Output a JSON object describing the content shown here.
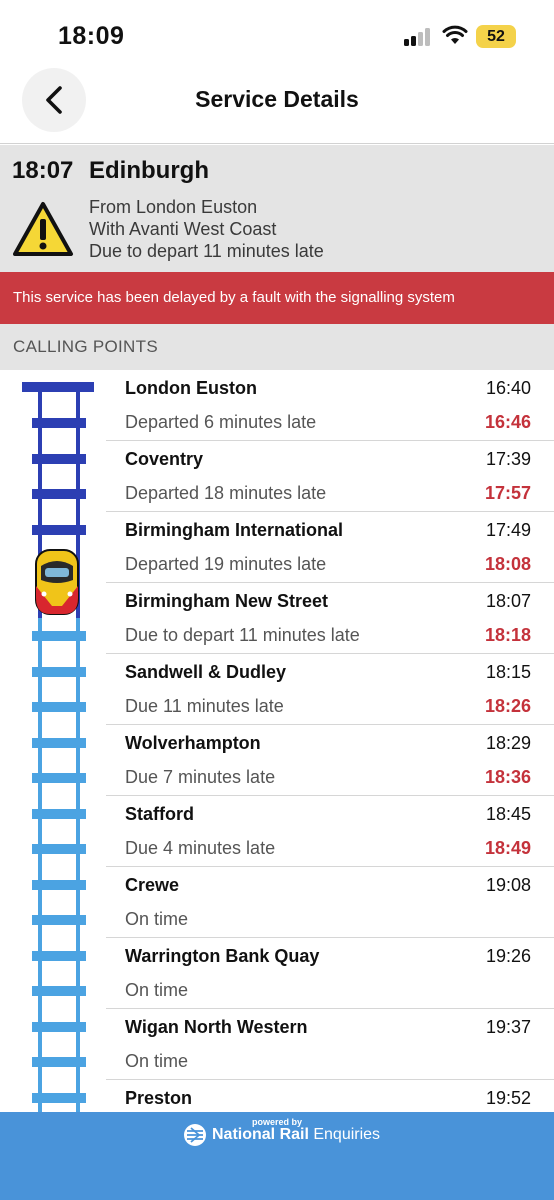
{
  "status_bar": {
    "time": "18:09",
    "battery": "52"
  },
  "header": {
    "title": "Service Details"
  },
  "service": {
    "time": "18:07",
    "destination": "Edinburgh",
    "lines": [
      "From London Euston",
      "With Avanti West Coast",
      "Due to depart 11 minutes late"
    ]
  },
  "alert": "This service has been delayed by a fault with the signalling system",
  "section_title": "CALLING POINTS",
  "colors": {
    "alert": "#c93a41",
    "late": "#c4323b",
    "track_passed": "#2c3fb3",
    "track_ahead": "#4ba3e2",
    "footer": "#4993d9"
  },
  "stops": [
    {
      "name": "London Euston",
      "scheduled": "16:40",
      "status": "Departed 6 minutes late",
      "actual": "16:46"
    },
    {
      "name": "Coventry",
      "scheduled": "17:39",
      "status": "Departed 18 minutes late",
      "actual": "17:57"
    },
    {
      "name": "Birmingham International",
      "scheduled": "17:49",
      "status": "Departed 19 minutes late",
      "actual": "18:08"
    },
    {
      "name": "Birmingham New Street",
      "scheduled": "18:07",
      "status": "Due to depart 11 minutes late",
      "actual": "18:18"
    },
    {
      "name": "Sandwell & Dudley",
      "scheduled": "18:15",
      "status": "Due 11 minutes late",
      "actual": "18:26"
    },
    {
      "name": "Wolverhampton",
      "scheduled": "18:29",
      "status": "Due 7 minutes late",
      "actual": "18:36"
    },
    {
      "name": "Stafford",
      "scheduled": "18:45",
      "status": "Due 4 minutes late",
      "actual": "18:49"
    },
    {
      "name": "Crewe",
      "scheduled": "19:08",
      "status": "On time",
      "actual": ""
    },
    {
      "name": "Warrington Bank Quay",
      "scheduled": "19:26",
      "status": "On time",
      "actual": ""
    },
    {
      "name": "Wigan North Western",
      "scheduled": "19:37",
      "status": "On time",
      "actual": ""
    },
    {
      "name": "Preston",
      "scheduled": "19:52",
      "status": "",
      "actual": ""
    }
  ],
  "footer": {
    "powered_by": "powered by",
    "brand_bold": "National Rail",
    "brand_light": " Enquiries"
  }
}
